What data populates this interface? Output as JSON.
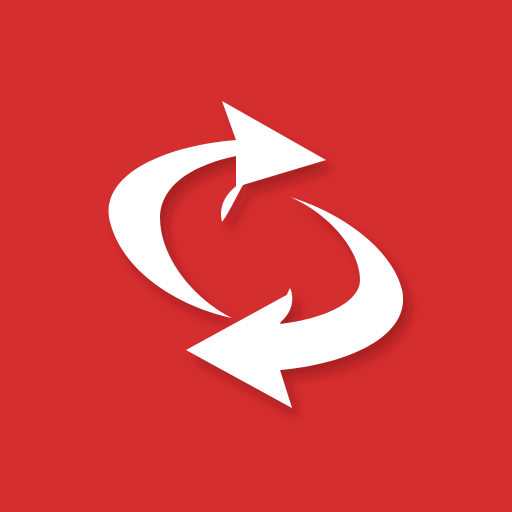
{
  "icon": {
    "name": "refresh-arrows-icon",
    "background_color": "#d42e2f",
    "arrow_color": "#ffffff",
    "shadow_color": "#8a1418"
  }
}
